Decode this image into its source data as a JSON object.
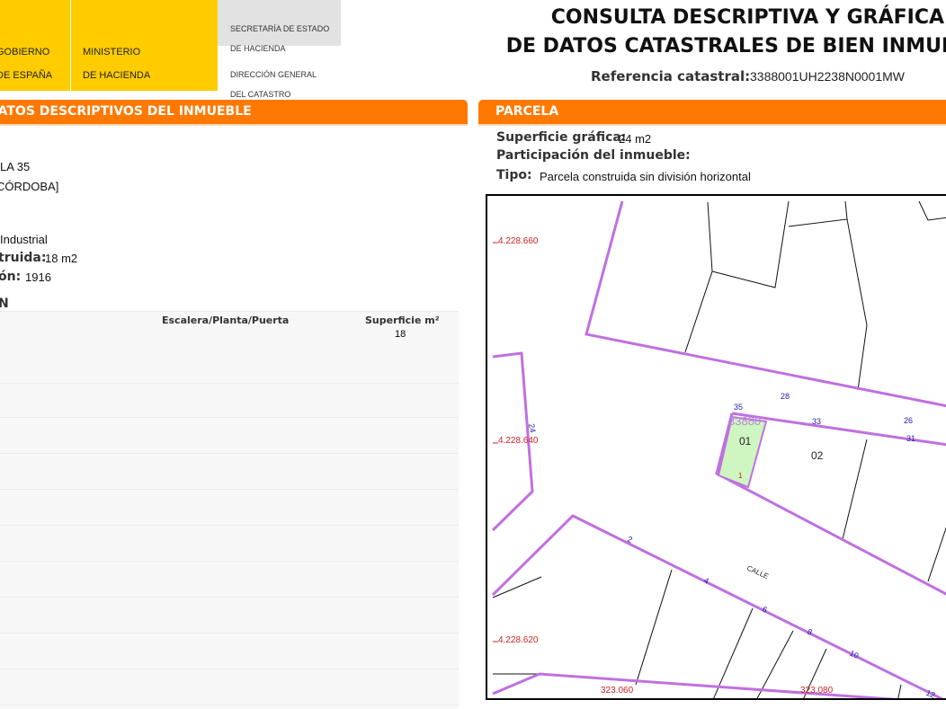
{
  "header": {
    "gov_line1": "GOBIERNO",
    "gov_line2": "DE ESPAÑA",
    "ministry_line1": "MINISTERIO",
    "ministry_line2": "DE HACIENDA",
    "secretary_line1": "SECRETARÍA DE ESTADO",
    "secretary_line2": "DE HACIENDA",
    "direction_line1": "DIRECCIÓN GENERAL",
    "direction_line2": "DEL CATASTRO",
    "title_line1": "CONSULTA DESCRIPTIVA Y GRÁFICA",
    "title_line2": "DE DATOS CATASTRALES DE BIEN INMUE",
    "ref_label": "Referencia catastral:",
    "ref_value": "3388001UH2238N0001MW"
  },
  "left_section": {
    "title": "DATOS DESCRIPTIVOS DEL INMUEBLE",
    "address_line1": "LA 35",
    "address_line2": "CÓRDOBA]",
    "use_value": "Industrial",
    "built_label": "truida:",
    "built_value": "18 m2",
    "year_label": "ón:",
    "year_value": "1916",
    "construction_heading": "N",
    "table": {
      "col_stair": "Escalera/Planta/Puerta",
      "col_surface": "Superficie m²",
      "row1_surface": "18"
    }
  },
  "right_section": {
    "title": "PARCELA",
    "surface_label": "Superficie gráfica:",
    "surface_value": "24 m2",
    "participation_label": "Participación del inmueble:",
    "type_label": "Tipo:",
    "type_value": "Parcela construida sin división horizontal"
  },
  "map": {
    "coord_y1": "4.228.660",
    "coord_y2": "4.228.640",
    "coord_y3": "4.228.620",
    "coord_x1": "323.060",
    "coord_x2": "323.080",
    "parcel_ref": "33880",
    "unit_01": "01",
    "unit_02": "02",
    "unit_1": "1",
    "street_label": "CALLE",
    "num_35": "35",
    "num_28": "28",
    "num_33": "33",
    "num_26": "26",
    "num_31": "31",
    "num_2": "2",
    "num_4": "4",
    "num_6": "6",
    "num_8": "8",
    "num_10": "10",
    "num_12": "12",
    "num_24": "24",
    "parcel_line_color": "#c070e0",
    "highlight_color": "#cff5c0"
  },
  "colors": {
    "header_yellow": "#ffcc00",
    "section_orange": "#ff7800",
    "coord_red": "#cc2222",
    "number_blue": "#2222aa"
  }
}
